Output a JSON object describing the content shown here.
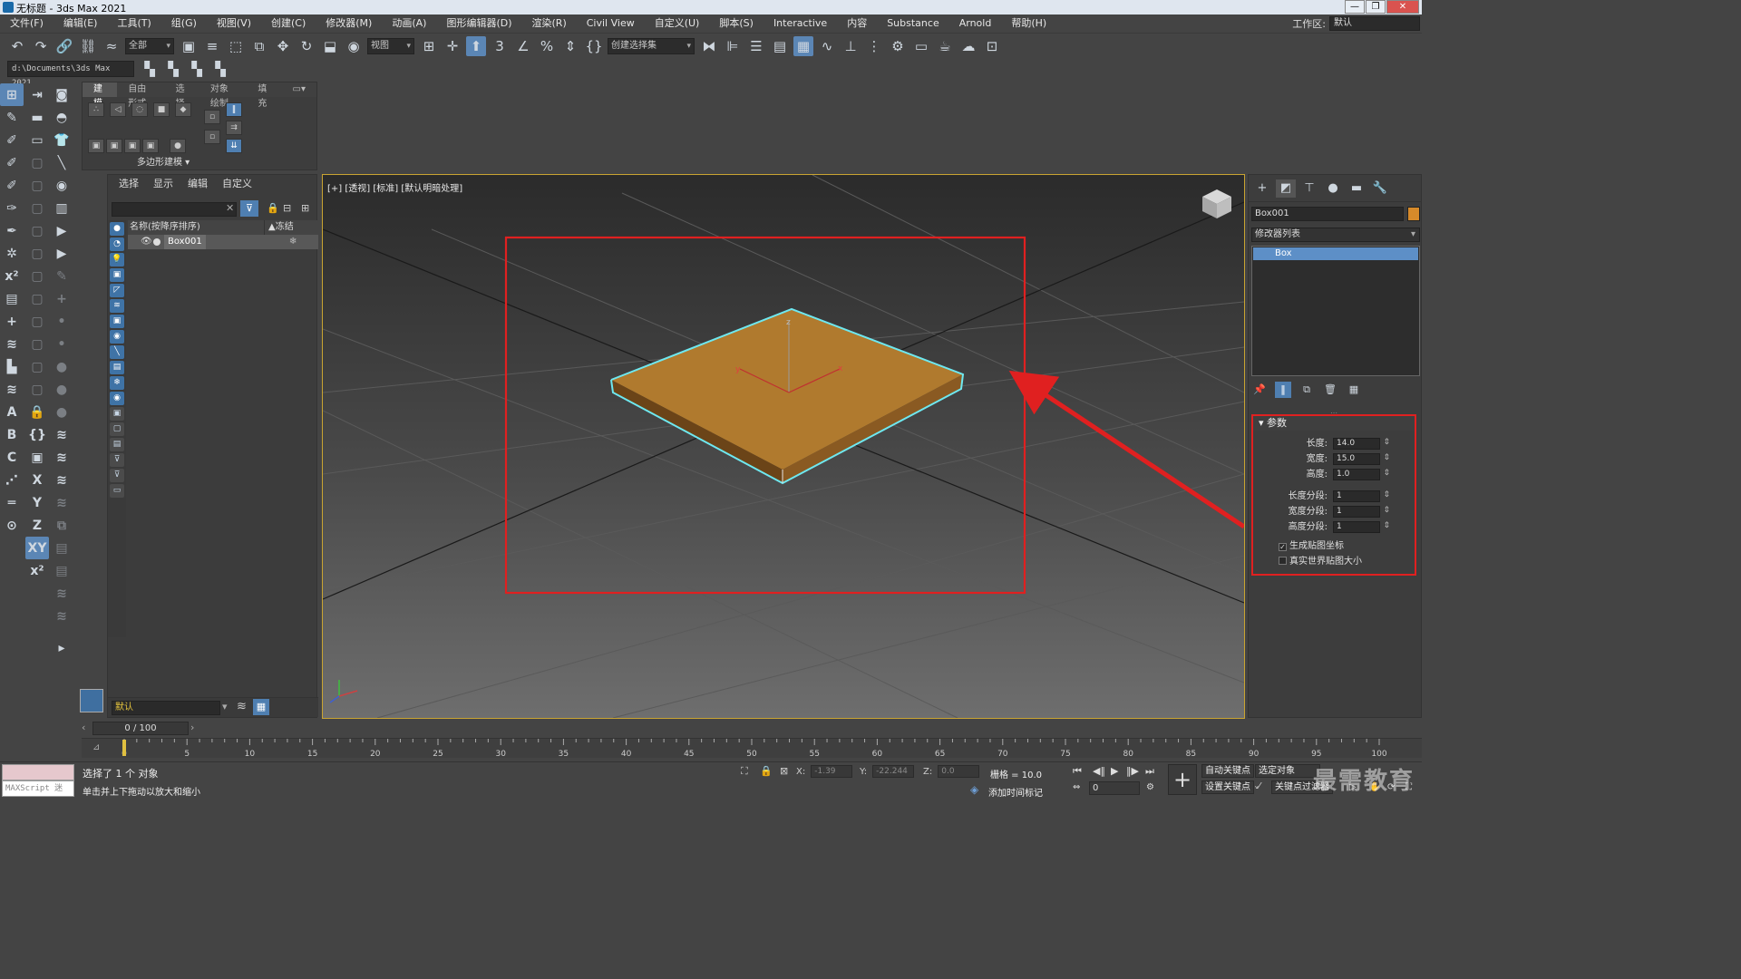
{
  "window": {
    "title": "无标题 - 3ds Max 2021",
    "controls": [
      "—",
      "❐",
      "✕"
    ]
  },
  "menubar": {
    "items": [
      "文件(F)",
      "编辑(E)",
      "工具(T)",
      "组(G)",
      "视图(V)",
      "创建(C)",
      "修改器(M)",
      "动画(A)",
      "图形编辑器(D)",
      "渲染(R)",
      "Civil View",
      "自定义(U)",
      "脚本(S)",
      "Interactive",
      "内容",
      "Substance",
      "Arnold",
      "帮助(H)"
    ],
    "workspace_label": "工作区:",
    "workspace_value": "默认"
  },
  "toolbar": {
    "selection_filter": "全部",
    "ref_coord": "视图",
    "named_selection": "创建选择集"
  },
  "toolbar2": {
    "project_path": "d:\\Documents\\3ds Max 2021"
  },
  "ribbon": {
    "tabs": [
      "建模",
      "自由形式",
      "选择",
      "对象绘制",
      "填充"
    ],
    "group_label": "多边形建模"
  },
  "scene_explorer": {
    "menus": [
      "选择",
      "显示",
      "编辑",
      "自定义"
    ],
    "column_name": "名称(按降序排序)",
    "column_frozen": "▲冻结",
    "object_name": "Box001",
    "layer": "默认"
  },
  "viewport": {
    "label": "[+] [透视] [标准] [默认明暗处理]",
    "axis_x": "x",
    "axis_y": "y",
    "axis_z": "z",
    "box_color": "#b07a2e",
    "selection_color": "#6ee8f0",
    "annotation_color": "#e02020"
  },
  "command_panel": {
    "object_name": "Box001",
    "object_color": "#d68a2a",
    "modifier_list": "修改器列表",
    "stack_item": "Box",
    "rollout_title": "参数",
    "params": [
      {
        "label": "长度:",
        "value": "14.0"
      },
      {
        "label": "宽度:",
        "value": "15.0"
      },
      {
        "label": "高度:",
        "value": "1.0"
      },
      {
        "label": "长度分段:",
        "value": "1"
      },
      {
        "label": "宽度分段:",
        "value": "1"
      },
      {
        "label": "高度分段:",
        "value": "1"
      }
    ],
    "gen_mapping": "生成贴图坐标",
    "gen_mapping_checked": true,
    "real_world": "真实世界贴图大小",
    "real_world_checked": false
  },
  "timeline": {
    "time_display": "0 / 100",
    "ticks": [
      0,
      5,
      10,
      15,
      20,
      25,
      30,
      35,
      40,
      45,
      50,
      55,
      60,
      65,
      70,
      75,
      80,
      85,
      90,
      95,
      100
    ]
  },
  "statusbar": {
    "maxscript": "MAXScript 迷",
    "selection_msg": "选择了 1 个 对象",
    "hint_msg": "单击并上下拖动以放大和缩小",
    "x_label": "X:",
    "x_value": "-1.39",
    "y_label": "Y:",
    "y_value": "-22.244",
    "z_label": "Z:",
    "z_value": "0.0",
    "grid": "栅格 = 10.0",
    "add_time_tag": "添加时间标记",
    "auto_key": "自动关键点",
    "selected_object": "选定对象",
    "set_key": "设置关键点",
    "key_filter": "关键点过滤器",
    "frame_value": "0",
    "watermark": "最需教育"
  }
}
